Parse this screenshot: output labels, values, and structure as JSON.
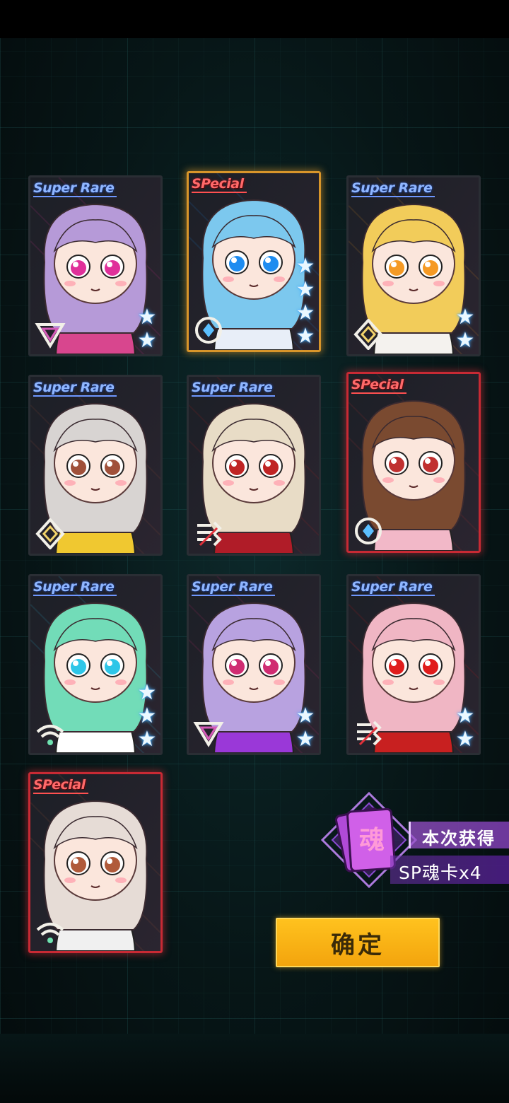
{
  "cards": [
    {
      "rarity": "Super Rare",
      "hair": "#b69ad8",
      "eyes": "#e0309a",
      "accent": "#d8468e",
      "stars": 2,
      "class": "triangle",
      "frame": "normal"
    },
    {
      "rarity": "SPecial",
      "hair": "#7cc8ee",
      "eyes": "#1e8cf0",
      "accent": "#e8eef8",
      "stars": 4,
      "class": "circle",
      "frame": "gold"
    },
    {
      "rarity": "Super Rare",
      "hair": "#f2cc5a",
      "eyes": "#f59a24",
      "accent": "#f4f2ee",
      "stars": 2,
      "class": "diamond",
      "frame": "normal"
    },
    {
      "rarity": "Super Rare",
      "hair": "#d8d4d2",
      "eyes": "#a0503a",
      "accent": "#f0c830",
      "stars": 0,
      "class": "diamond",
      "frame": "normal"
    },
    {
      "rarity": "Super Rare",
      "hair": "#e8dcc6",
      "eyes": "#c02424",
      "accent": "#b01c28",
      "stars": 0,
      "class": "slash",
      "frame": "normal"
    },
    {
      "rarity": "SPecial",
      "hair": "#7a4a30",
      "eyes": "#c03030",
      "accent": "#f2b8c8",
      "stars": 0,
      "class": "circle",
      "frame": "red"
    },
    {
      "rarity": "Super Rare",
      "hair": "#72dcb8",
      "eyes": "#2ec6e8",
      "accent": "#ffffff",
      "stars": 3,
      "class": "wifi",
      "frame": "normal"
    },
    {
      "rarity": "Super Rare",
      "hair": "#b8a2e0",
      "eyes": "#d02c72",
      "accent": "#9a38d8",
      "stars": 2,
      "class": "triangle",
      "frame": "normal"
    },
    {
      "rarity": "Super Rare",
      "hair": "#f0b6c4",
      "eyes": "#e01c1c",
      "accent": "#c82020",
      "stars": 2,
      "class": "slash",
      "frame": "normal"
    },
    {
      "rarity": "SPecial",
      "hair": "#e6dcd6",
      "eyes": "#b05a3a",
      "accent": "#f0f0f0",
      "stars": 0,
      "class": "wifi",
      "frame": "red"
    }
  ],
  "reward": {
    "icon_char": "魂",
    "title": "本次获得",
    "value": "SP魂卡x4",
    "color": "#a95ce0"
  },
  "confirm_label": "确定"
}
